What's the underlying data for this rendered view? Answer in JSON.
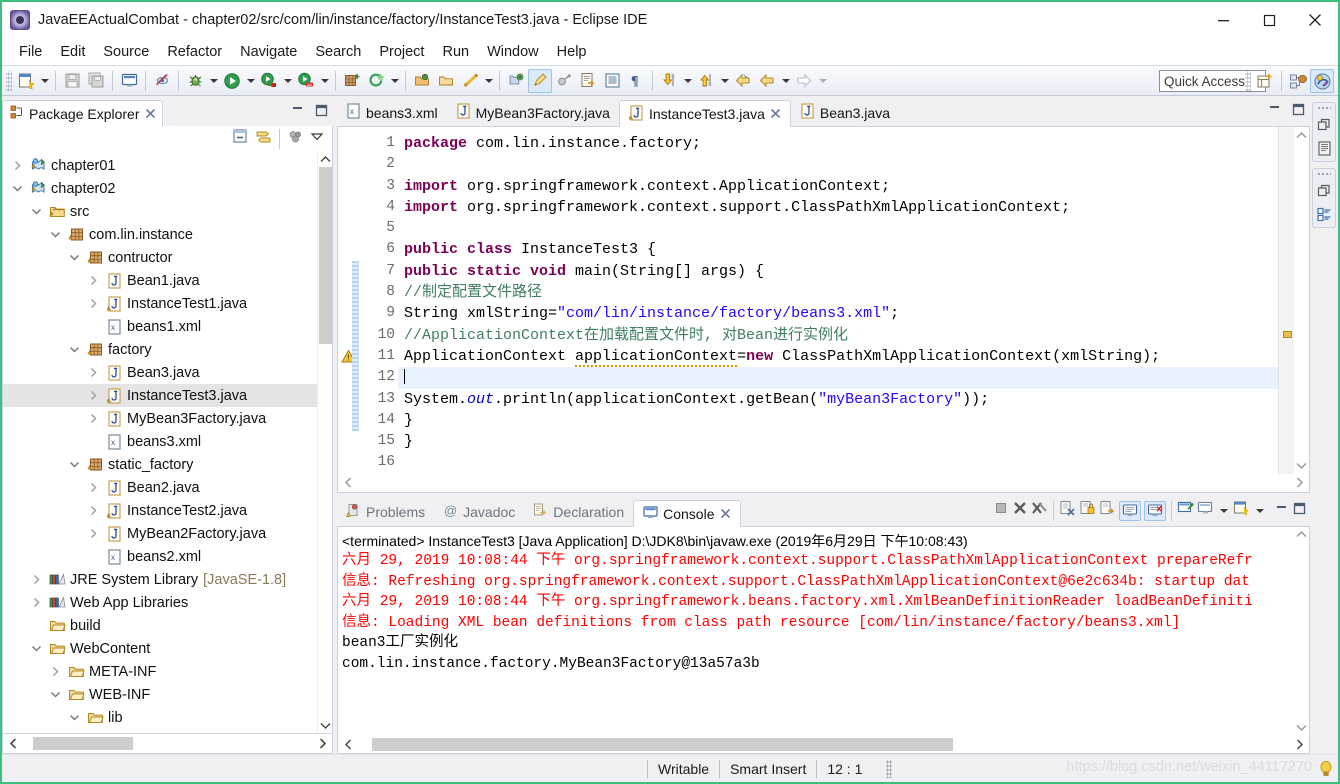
{
  "window": {
    "title": "JavaEEActualCombat - chapter02/src/com/lin/instance/factory/InstanceTest3.java - Eclipse IDE",
    "app_icon": "eclipse-icon",
    "minimize": "minimize-icon",
    "maximize": "maximize-icon",
    "close": "close-icon"
  },
  "menubar": {
    "items": [
      "File",
      "Edit",
      "Source",
      "Refactor",
      "Navigate",
      "Search",
      "Project",
      "Run",
      "Window",
      "Help"
    ]
  },
  "toolbar": {
    "quick_access_placeholder": "Quick Access",
    "icons": [
      "new-wizard-icon",
      "save-icon",
      "save-all-icon",
      "print-icon",
      "toggle-mark-occurrences-icon",
      "debug-icon",
      "run-icon",
      "run-external-tools-icon",
      "coverage-icon",
      "new-java-package-icon",
      "new-annotation-icon",
      "open-type-icon",
      "open-task-icon",
      "search-icon",
      "last-edit-location-icon",
      "toggle-block-selection-icon",
      "show-whitespace-icon",
      "next-annotation-icon",
      "previous-annotation-icon",
      "back-icon",
      "forward-icon"
    ],
    "perspective_icons": [
      "open-perspective-icon",
      "java-ee-perspective-icon",
      "java-perspective-icon"
    ]
  },
  "explorer": {
    "tab_label": "Package Explorer",
    "tab_icon": "package-explorer-icon",
    "close_icon": "close-icon",
    "minimize_icon": "minimize-view-icon",
    "maximize_icon": "maximize-view-icon",
    "toolbar_icons": [
      "collapse-all-icon",
      "link-with-editor-icon",
      "focus-on-active-task-icon",
      "view-menu-icon"
    ],
    "tree": [
      {
        "label": "chapter01",
        "indent": 0,
        "twist": "collapsed",
        "icon": "java-web-project-icon",
        "selected": false
      },
      {
        "label": "chapter02",
        "indent": 0,
        "twist": "expanded",
        "icon": "java-web-project-icon",
        "selected": false
      },
      {
        "label": "src",
        "indent": 1,
        "twist": "expanded",
        "icon": "source-folder-icon",
        "selected": false
      },
      {
        "label": "com.lin.instance",
        "indent": 2,
        "twist": "expanded",
        "icon": "package-icon",
        "selected": false
      },
      {
        "label": "contructor",
        "indent": 3,
        "twist": "expanded",
        "icon": "package-icon",
        "selected": false
      },
      {
        "label": "Bean1.java",
        "indent": 4,
        "twist": "collapsed",
        "icon": "java-file-icon",
        "selected": false
      },
      {
        "label": "InstanceTest1.java",
        "indent": 4,
        "twist": "collapsed",
        "icon": "java-file-warning-icon",
        "selected": false
      },
      {
        "label": "beans1.xml",
        "indent": 4,
        "twist": "none",
        "icon": "xml-file-icon",
        "selected": false
      },
      {
        "label": "factory",
        "indent": 3,
        "twist": "expanded",
        "icon": "package-icon",
        "selected": false
      },
      {
        "label": "Bean3.java",
        "indent": 4,
        "twist": "collapsed",
        "icon": "java-file-icon",
        "selected": false
      },
      {
        "label": "InstanceTest3.java",
        "indent": 4,
        "twist": "collapsed",
        "icon": "java-file-warning-icon",
        "selected": true
      },
      {
        "label": "MyBean3Factory.java",
        "indent": 4,
        "twist": "collapsed",
        "icon": "java-file-icon",
        "selected": false
      },
      {
        "label": "beans3.xml",
        "indent": 4,
        "twist": "none",
        "icon": "xml-file-icon",
        "selected": false
      },
      {
        "label": "static_factory",
        "indent": 3,
        "twist": "expanded",
        "icon": "package-icon",
        "selected": false
      },
      {
        "label": "Bean2.java",
        "indent": 4,
        "twist": "collapsed",
        "icon": "java-file-icon",
        "selected": false
      },
      {
        "label": "InstanceTest2.java",
        "indent": 4,
        "twist": "collapsed",
        "icon": "java-file-warning-icon",
        "selected": false
      },
      {
        "label": "MyBean2Factory.java",
        "indent": 4,
        "twist": "collapsed",
        "icon": "java-file-icon",
        "selected": false
      },
      {
        "label": "beans2.xml",
        "indent": 4,
        "twist": "none",
        "icon": "xml-file-icon",
        "selected": false
      },
      {
        "label": "JRE System Library",
        "label2": "[JavaSE-1.8]",
        "indent": 1,
        "twist": "collapsed",
        "icon": "library-icon",
        "selected": false
      },
      {
        "label": "Web App Libraries",
        "indent": 1,
        "twist": "collapsed",
        "icon": "library-icon",
        "selected": false
      },
      {
        "label": "build",
        "indent": 1,
        "twist": "none",
        "icon": "folder-icon",
        "selected": false
      },
      {
        "label": "WebContent",
        "indent": 1,
        "twist": "expanded",
        "icon": "folder-icon",
        "selected": false
      },
      {
        "label": "META-INF",
        "indent": 2,
        "twist": "collapsed",
        "icon": "folder-icon",
        "selected": false
      },
      {
        "label": "WEB-INF",
        "indent": 2,
        "twist": "expanded",
        "icon": "folder-icon",
        "selected": false
      },
      {
        "label": "lib",
        "indent": 3,
        "twist": "expanded",
        "icon": "folder-icon",
        "selected": false
      }
    ]
  },
  "editor": {
    "tabs": [
      {
        "label": "beans3.xml",
        "icon": "xml-file-icon",
        "active": false
      },
      {
        "label": "MyBean3Factory.java",
        "icon": "java-file-icon",
        "active": false
      },
      {
        "label": "InstanceTest3.java",
        "icon": "java-file-warning-icon",
        "active": true
      },
      {
        "label": "Bean3.java",
        "icon": "java-file-icon",
        "active": false
      }
    ],
    "close_icon": "close-icon",
    "minimize_icon": "minimize-view-icon",
    "maximize_icon": "maximize-view-icon",
    "line_numbers": [
      "1",
      "2",
      "3",
      "4",
      "5",
      "6",
      "7",
      "8",
      "9",
      "10",
      "11",
      "12",
      "13",
      "14",
      "15",
      "16"
    ],
    "current_line": 12,
    "code": [
      {
        "n": "1",
        "segments": [
          {
            "t": "package ",
            "c": "kw"
          },
          {
            "t": "com.lin.instance.factory;",
            "c": ""
          }
        ]
      },
      {
        "n": "2",
        "segments": []
      },
      {
        "n": "3",
        "fold": true,
        "segments": [
          {
            "t": "import ",
            "c": "kw"
          },
          {
            "t": "org.springframework.context.ApplicationContext;",
            "c": ""
          }
        ]
      },
      {
        "n": "4",
        "segments": [
          {
            "t": "import ",
            "c": "kw"
          },
          {
            "t": "org.springframework.context.support.ClassPathXmlApplicationContext;",
            "c": ""
          }
        ]
      },
      {
        "n": "5",
        "segments": []
      },
      {
        "n": "6",
        "segments": [
          {
            "t": "public class ",
            "c": "kw"
          },
          {
            "t": "InstanceTest3 {",
            "c": ""
          }
        ]
      },
      {
        "n": "7",
        "fold": true,
        "segments": [
          {
            "t": "    public static void ",
            "c": "kw"
          },
          {
            "t": "main(String[] args) {",
            "c": ""
          }
        ]
      },
      {
        "n": "8",
        "segments": [
          {
            "t": "        //制定配置文件路径",
            "c": "cmt"
          }
        ]
      },
      {
        "n": "9",
        "segments": [
          {
            "t": "        String xmlString=",
            "c": ""
          },
          {
            "t": "\"com/lin/instance/factory/beans3.xml\"",
            "c": "str"
          },
          {
            "t": ";",
            "c": ""
          }
        ]
      },
      {
        "n": "10",
        "segments": [
          {
            "t": "        //ApplicationContext在加载配置文件时, 对Bean进行实例化",
            "c": "cmt"
          }
        ]
      },
      {
        "n": "11",
        "segments": [
          {
            "t": "        ApplicationContext ",
            "c": ""
          },
          {
            "t": "applicationContext",
            "c": "sq"
          },
          {
            "t": "=",
            "c": ""
          },
          {
            "t": "new ",
            "c": "kw"
          },
          {
            "t": "ClassPathXmlApplicationContext(xmlString);",
            "c": ""
          }
        ]
      },
      {
        "n": "12",
        "segments": [],
        "current": true
      },
      {
        "n": "13",
        "segments": [
          {
            "t": "        System.",
            "c": ""
          },
          {
            "t": "out",
            "c": "fld stat"
          },
          {
            "t": ".println(applicationContext.getBean(",
            "c": ""
          },
          {
            "t": "\"myBean3Factory\"",
            "c": "str"
          },
          {
            "t": "));",
            "c": ""
          }
        ]
      },
      {
        "n": "14",
        "segments": [
          {
            "t": "    }",
            "c": ""
          }
        ]
      },
      {
        "n": "15",
        "segments": [
          {
            "t": "}",
            "c": ""
          }
        ]
      },
      {
        "n": "16",
        "segments": []
      }
    ]
  },
  "console": {
    "tabs": [
      {
        "label": "Problems",
        "icon": "problems-icon",
        "active": false
      },
      {
        "label": "Javadoc",
        "icon": "javadoc-icon",
        "active": false
      },
      {
        "label": "Declaration",
        "icon": "declaration-icon",
        "active": false
      },
      {
        "label": "Console",
        "icon": "console-icon",
        "active": true
      }
    ],
    "close_icon": "close-icon",
    "toolbar_icons": [
      "terminate-icon",
      "remove-launch-icon",
      "remove-all-terminated-icon",
      "clear-console-icon",
      "scroll-lock-icon",
      "word-wrap-icon",
      "show-console-on-output-icon",
      "show-console-on-error-icon",
      "pin-console-icon",
      "display-selected-console-icon",
      "display-selected-console-menu-icon",
      "open-console-icon",
      "open-console-menu-icon",
      "minimize-view-icon",
      "maximize-view-icon"
    ],
    "lines": [
      {
        "kind": "hdr",
        "text": "<terminated> InstanceTest3 [Java Application] D:\\JDK8\\bin\\javaw.exe (2019年6月29日 下午10:08:43)"
      },
      {
        "kind": "err",
        "text": "六月 29, 2019 10:08:44 下午 org.springframework.context.support.ClassPathXmlApplicationContext prepareRefr"
      },
      {
        "kind": "err",
        "text": "信息: Refreshing org.springframework.context.support.ClassPathXmlApplicationContext@6e2c634b: startup dat"
      },
      {
        "kind": "err",
        "text": "六月 29, 2019 10:08:44 下午 org.springframework.beans.factory.xml.XmlBeanDefinitionReader loadBeanDefiniti"
      },
      {
        "kind": "err",
        "text": "信息: Loading XML bean definitions from class path resource [com/lin/instance/factory/beans3.xml]"
      },
      {
        "kind": "out",
        "text": "bean3工厂实例化"
      },
      {
        "kind": "out",
        "text": "com.lin.instance.factory.MyBean3Factory@13a57a3b"
      }
    ]
  },
  "minibar": {
    "groups": [
      {
        "restore": "restore-icon",
        "view": "editor-area-icon"
      },
      {
        "restore": "restore-icon",
        "view": "outline-view-icon"
      }
    ]
  },
  "statusbar": {
    "writable": "Writable",
    "insert_mode": "Smart Insert",
    "position": "12 : 1",
    "watermark": "https://blog.csdn.net/weixin_44117270",
    "bulb_icon": "tip-bulb-icon"
  }
}
